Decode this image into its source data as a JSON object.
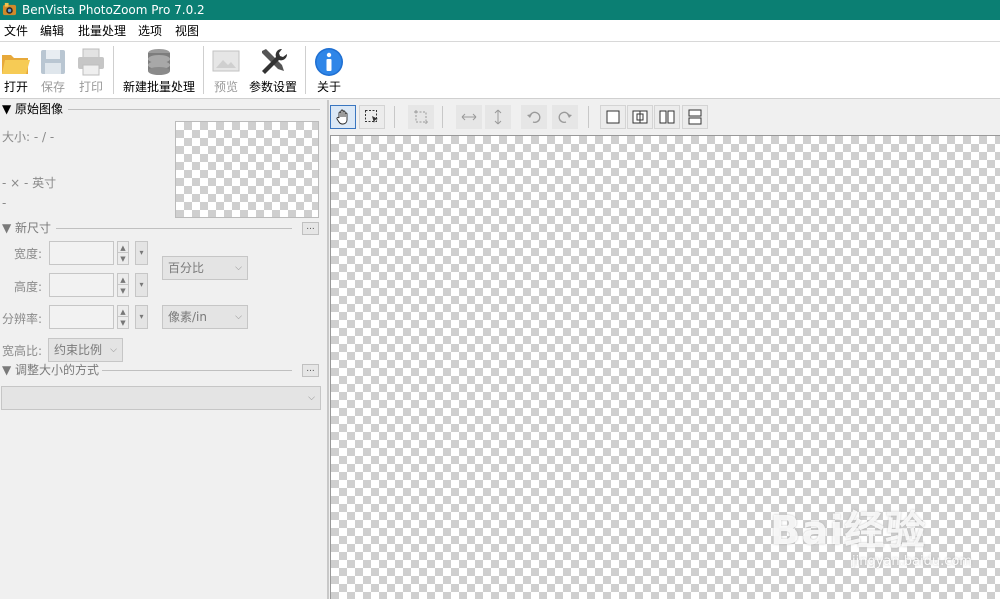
{
  "window": {
    "title": "BenVista PhotoZoom Pro 7.0.2"
  },
  "menu": [
    "文件",
    "编辑",
    "批量处理",
    "选项",
    "视图"
  ],
  "toolbar": {
    "open": "打开",
    "save": "保存",
    "print": "打印",
    "new_batch": "新建批量处理",
    "preview": "预览",
    "settings": "参数设置",
    "about": "关于"
  },
  "original": {
    "section_title": "▼ 原始图像",
    "size_text": "大小: - / -",
    "dims_text": "- × - 英寸",
    "extra_text": "-"
  },
  "new_size": {
    "section_title": "▼ 新尺寸",
    "more": "...",
    "width_label": "宽度:",
    "height_label": "高度:",
    "resolution_label": "分辨率:",
    "width_value": "",
    "height_value": "",
    "resolution_value": "",
    "unit_select": "百分比",
    "resolution_unit": "像素/in",
    "aspect_label": "宽高比:",
    "aspect_select": "约束比例"
  },
  "resize_method": {
    "section_title": "▼ 调整大小的方式",
    "more": "...",
    "selected": ""
  },
  "canvas_tools": [
    "hand-tool",
    "select-tool",
    "crop-tool",
    "flip-horizontal",
    "flip-vertical",
    "rotate-left",
    "rotate-right",
    "single-view",
    "split-view-vertical",
    "side-by-side-view",
    "split-view-horizontal"
  ],
  "watermark": {
    "brand": "Bai经验",
    "url": "jingyan.baidu.com"
  },
  "colors": {
    "titlebar": "#0b7f73",
    "accent": "#3a76c0"
  }
}
